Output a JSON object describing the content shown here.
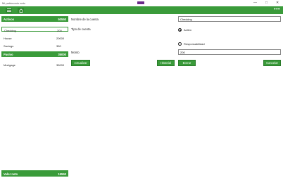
{
  "window": {
    "title": "Mi patrimonio neto",
    "controls": {
      "minimize": "—",
      "maximize": "□",
      "close": "✕"
    }
  },
  "toolbar": {
    "menu_icon": "hamburger-icon",
    "home_icon": "home-icon",
    "more_label": "•••"
  },
  "assets": {
    "title": "Activos",
    "total": "50550",
    "items": [
      {
        "label": "Checking",
        "value": "200"
      },
      {
        "label": "House",
        "value": "20000"
      },
      {
        "label": "Savings",
        "value": "350"
      }
    ]
  },
  "liabilities": {
    "title": "Pasivo",
    "total": "35000",
    "items": [
      {
        "label": "Mortgage",
        "value": "35000"
      }
    ]
  },
  "net_worth": {
    "label": "Valor neto",
    "value": "15550"
  },
  "form": {
    "account_name_label": "Nombre de la cuenta",
    "account_name_value": "Checking",
    "account_type_label": "Tipo de cuenta",
    "type_asset_label": "Activo",
    "type_liability_label": "Responsabilidad",
    "amount_label": "Monto",
    "amount_value": "200"
  },
  "buttons": {
    "update": "Actualizar",
    "history": "Historial",
    "delete": "Borrar",
    "cancel": "Cancelar"
  },
  "colors": {
    "accent": "#3a9b3a"
  }
}
